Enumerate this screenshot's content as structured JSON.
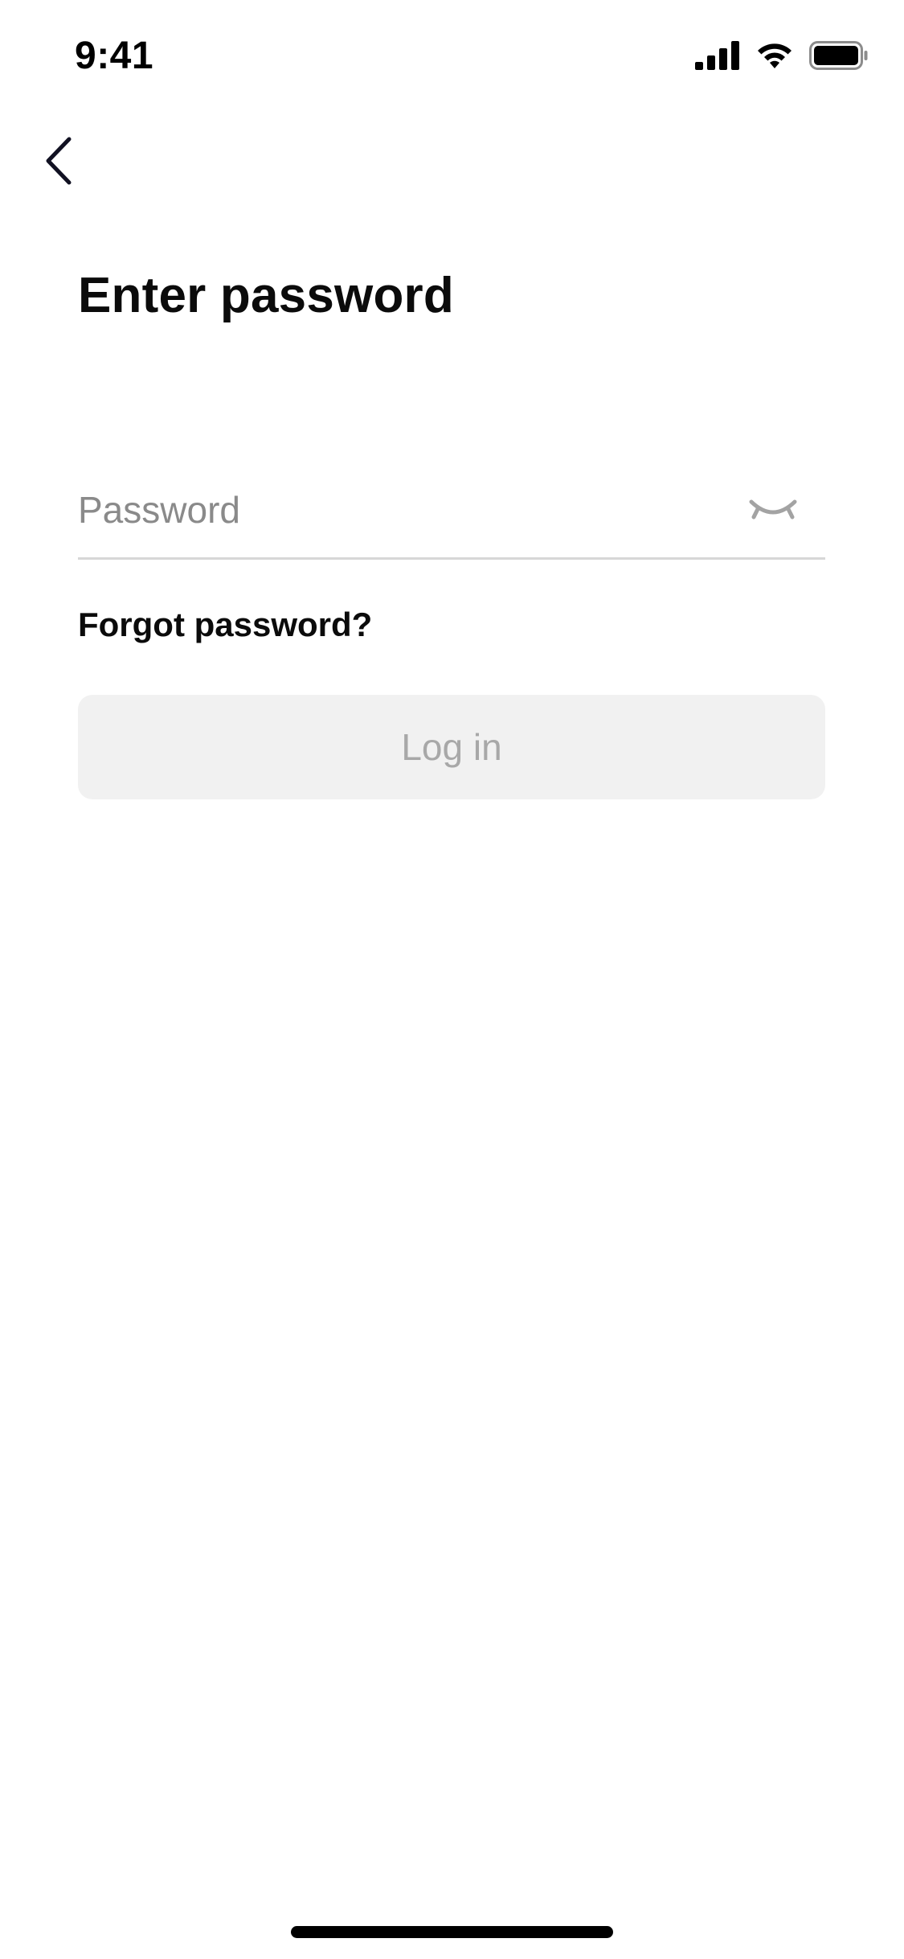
{
  "status_bar": {
    "time": "9:41"
  },
  "header": {
    "back_icon": "chevron-left-icon",
    "title": "Enter password"
  },
  "form": {
    "password": {
      "value": "",
      "placeholder": "Password",
      "toggle_icon": "eye-closed-icon"
    },
    "forgot_label": "Forgot password?",
    "login_label": "Log in"
  },
  "colors": {
    "text_primary": "#0b0b0b",
    "placeholder": "#8a8a8a",
    "divider": "#d7d7d7",
    "button_disabled_bg": "#f1f1f1",
    "button_disabled_text": "#a8a8a8"
  }
}
